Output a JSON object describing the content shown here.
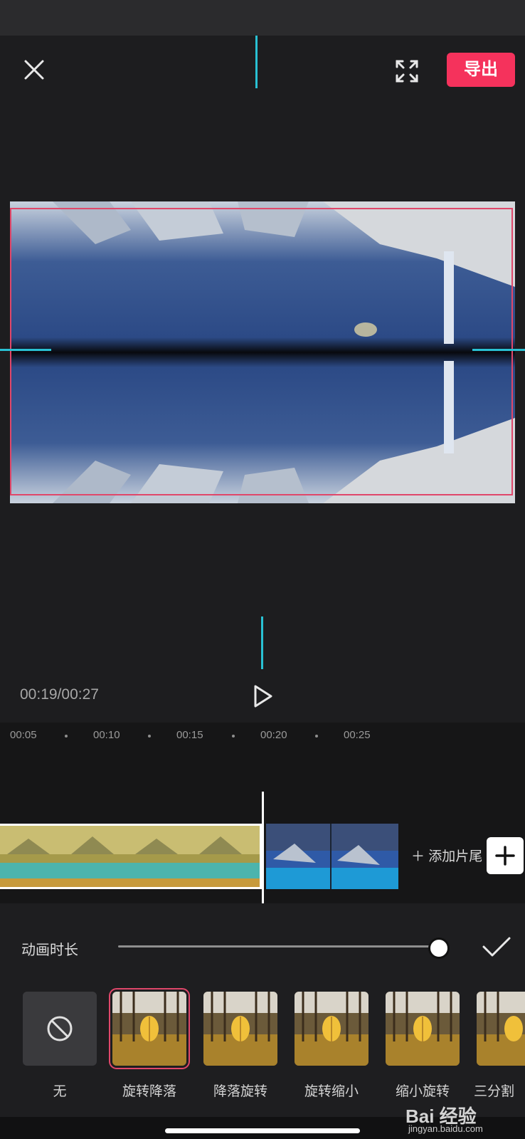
{
  "header": {
    "export_label": "导出"
  },
  "player": {
    "timecode": "00:19/00:27"
  },
  "ruler": {
    "ticks": [
      "00:05",
      "00:10",
      "00:15",
      "00:20",
      "00:25"
    ]
  },
  "track": {
    "add_ending_label": "添加片尾"
  },
  "panel": {
    "duration_label": "动画时长",
    "duration_value": 1.0,
    "animations": [
      {
        "label": "无",
        "icon": "none-icon"
      },
      {
        "label": "旋转降落",
        "selected": true
      },
      {
        "label": "降落旋转"
      },
      {
        "label": "旋转缩小"
      },
      {
        "label": "缩小旋转"
      },
      {
        "label": "三分割"
      }
    ]
  },
  "watermark": {
    "brand": "Bai 经验",
    "url": "jingyan.baidu.com"
  },
  "colors": {
    "accent": "#f5325c",
    "guide": "#29c1d3",
    "selection": "#e0476a"
  }
}
